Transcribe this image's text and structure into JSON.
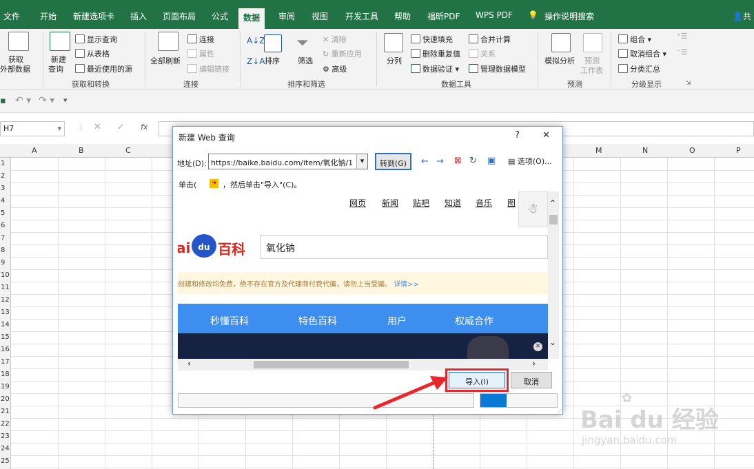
{
  "tabs": [
    {
      "label": "文件"
    },
    {
      "label": "开始"
    },
    {
      "label": "新建选项卡"
    },
    {
      "label": "插入"
    },
    {
      "label": "页面布局"
    },
    {
      "label": "公式"
    },
    {
      "label": "数据"
    },
    {
      "label": "审阅"
    },
    {
      "label": "视图"
    },
    {
      "label": "开发工具"
    },
    {
      "label": "帮助"
    },
    {
      "label": "福昕PDF"
    },
    {
      "label": "WPS PDF"
    },
    {
      "label": "操作说明搜索"
    }
  ],
  "share_label": "共",
  "ribbon": {
    "get_external": "获取",
    "get_external2": "外部数据",
    "new_query": "新建",
    "new_query2": "查询",
    "show_queries": "显示查询",
    "from_table": "从表格",
    "recent_sources": "最近使用的源",
    "group_get_transform": "获取和转换",
    "refresh_all": "全部刷新",
    "connections": "连接",
    "properties": "属性",
    "edit_links": "编辑链接",
    "group_connections": "连接",
    "sort": "排序",
    "filter": "筛选",
    "clear": "清除",
    "reapply": "重新应用",
    "advanced": "高级",
    "group_sort_filter": "排序和筛选",
    "text_to_columns": "分列",
    "flash_fill": "快速填充",
    "remove_duplicates": "删除重复值",
    "data_validation": "数据验证",
    "consolidate": "合并计算",
    "relationships": "关系",
    "manage_model": "管理数据模型",
    "group_data_tools": "数据工具",
    "what_if": "模拟分析",
    "forecast_sheet": "预测",
    "forecast_sheet2": "工作表",
    "group_forecast": "预测",
    "group_btn": "组合",
    "ungroup": "取消组合",
    "subtotal": "分类汇总",
    "group_outline": "分级显示"
  },
  "formula_bar": {
    "name_box": "H7",
    "fx": "fx"
  },
  "columns": [
    "A",
    "B",
    "C",
    "M",
    "N",
    "O",
    "P"
  ],
  "rows": [
    "1",
    "2",
    "3",
    "4",
    "5",
    "6",
    "7",
    "8",
    "9",
    "10",
    "11",
    "12",
    "13",
    "14",
    "15",
    "16",
    "17",
    "18",
    "19",
    "20",
    "21",
    "22",
    "23",
    "24",
    "25"
  ],
  "dialog": {
    "title": "新建 Web 查询",
    "help": "?",
    "close": "✕",
    "address_label": "地址(D):",
    "address_value": "https://baike.baidu.com/item/氧化钠/1",
    "go_button": "转到(G)",
    "options_button": "选项(O)...",
    "hint_prefix": "单击(",
    "hint_suffix": "，然后单击\"导入\"(C)。",
    "import_button": "导入(I)",
    "cancel_button": "取消"
  },
  "webpage": {
    "nav_links": [
      "网页",
      "新闻",
      "贴吧",
      "知道",
      "音乐",
      "图"
    ],
    "logo_text1": "ai",
    "logo_text2": "du",
    "logo_text3": "百科",
    "search_value": "氧化钠",
    "notice": "创建和修改均免费，绝不存在官方及代理商付费代编，请勿上当受骗。",
    "notice_link": "详情>>",
    "bar_items": [
      "秒懂百科",
      "特色百科",
      "用户",
      "权威合作"
    ]
  },
  "watermark": {
    "brand": "Bai du 经验",
    "url": "jingyan.baidu.com"
  },
  "colors": {
    "excel_green": "#217346",
    "annotation_red": "#e8262c",
    "baidu_blue": "#3e8ef0",
    "baidu_red": "#e1251b"
  }
}
